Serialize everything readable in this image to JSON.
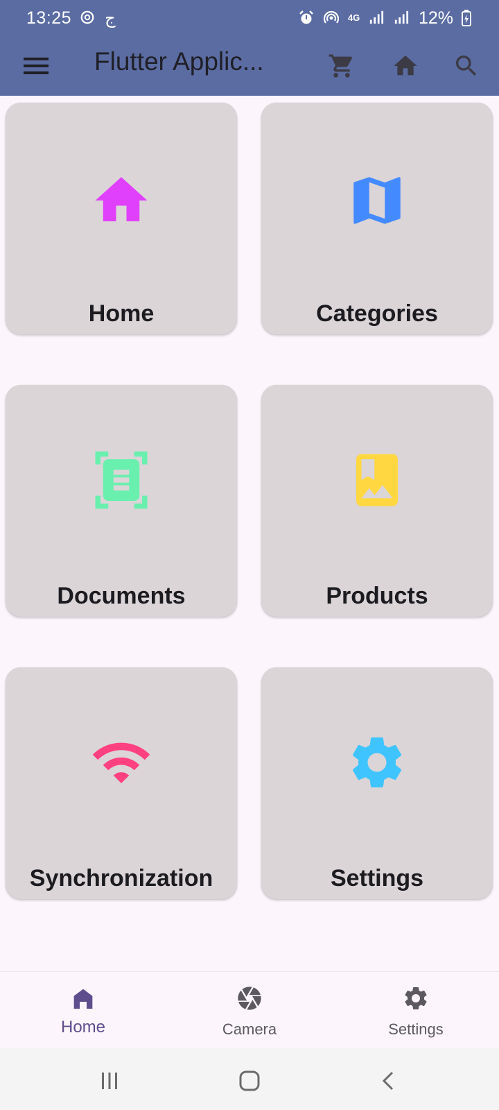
{
  "status_bar": {
    "time": "13:25",
    "left_extra": "ج",
    "network": "4G",
    "battery": "12%",
    "icons": [
      "sync-icon",
      "alarm-icon",
      "hotspot-icon",
      "signal-icon",
      "signal-icon",
      "battery-charging-icon"
    ]
  },
  "app_bar": {
    "title": "Flutter Applic...",
    "icons": [
      "menu-icon",
      "cart-icon",
      "home-icon",
      "search-icon"
    ]
  },
  "grid": {
    "items": [
      {
        "label": "Home",
        "icon": "home-icon",
        "color": "#e040fb"
      },
      {
        "label": "Categories",
        "icon": "map-icon",
        "color": "#448aff"
      },
      {
        "label": "Documents",
        "icon": "document-scanner-icon",
        "color": "#69f0ae"
      },
      {
        "label": "Products",
        "icon": "photo-album-icon",
        "color": "#ffd740"
      },
      {
        "label": "Synchronization",
        "icon": "wifi-icon",
        "color": "#ff4081"
      },
      {
        "label": "Settings",
        "icon": "settings-icon",
        "color": "#40c4ff"
      }
    ]
  },
  "bottom_nav": {
    "items": [
      {
        "label": "Home",
        "icon": "home-icon",
        "selected": true
      },
      {
        "label": "Camera",
        "icon": "camera-icon",
        "selected": false
      },
      {
        "label": "Settings",
        "icon": "settings-icon",
        "selected": false
      }
    ],
    "selected_color": "#5e4e8e",
    "unselected_color": "#5c5960"
  },
  "system_nav": {
    "icons": [
      "recents-icon",
      "home-button-icon",
      "back-icon"
    ]
  }
}
